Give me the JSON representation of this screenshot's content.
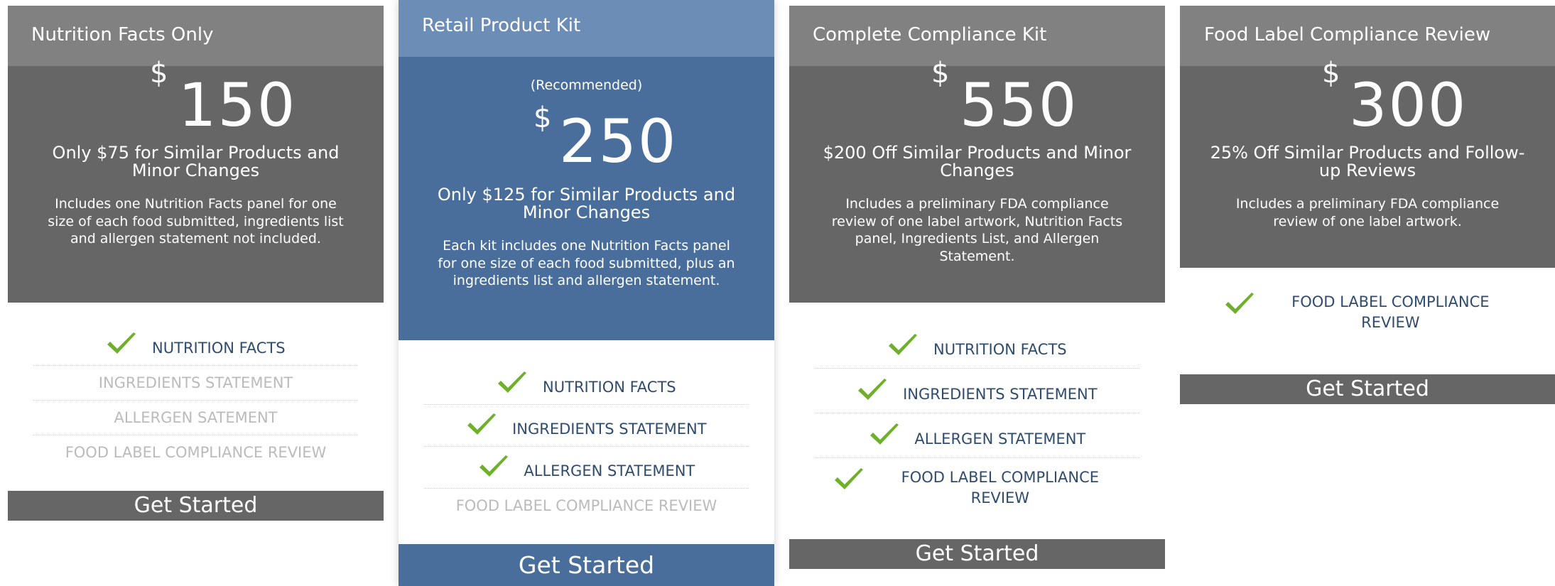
{
  "colors": {
    "header_gray": "#818181",
    "body_gray": "#666666",
    "header_blue": "#6c8db5",
    "body_blue": "#4a6e9b",
    "check_green": "#6fb02a",
    "feature_text": "#2f4b6e",
    "feature_disabled": "#bbbbbb"
  },
  "plans": [
    {
      "title": "Nutrition Facts Only",
      "currency": "$",
      "price": "150",
      "subtitle": "Only $75 for Similar Products and Minor Changes",
      "description": "Includes one Nutrition Facts panel for one size of each food submitted, ingredients list and allergen statement not included.",
      "features": [
        {
          "label": "NUTRITION FACTS",
          "included": true,
          "icon": "check-icon"
        },
        {
          "label": "INGREDIENTS STATEMENT",
          "included": false
        },
        {
          "label": "ALLERGEN SATEMENT",
          "included": false
        },
        {
          "label": "FOOD LABEL COMPLIANCE REVIEW",
          "included": false
        }
      ],
      "cta": "Get Started"
    },
    {
      "title": "Retail Product Kit",
      "recommended": "(Recommended)",
      "currency": "$",
      "price": "250",
      "subtitle": "Only $125 for Similar Products and Minor Changes",
      "description": "Each kit includes one Nutrition Facts panel for one size of each food submitted, plus an ingredients list and allergen statement.",
      "features": [
        {
          "label": "NUTRITION FACTS",
          "included": true,
          "icon": "check-icon"
        },
        {
          "label": "INGREDIENTS STATEMENT",
          "included": true,
          "icon": "check-icon"
        },
        {
          "label": "ALLERGEN STATEMENT",
          "included": true,
          "icon": "check-icon"
        },
        {
          "label": "FOOD LABEL COMPLIANCE REVIEW",
          "included": false
        }
      ],
      "cta": "Get Started"
    },
    {
      "title": "Complete Compliance Kit",
      "currency": "$",
      "price": "550",
      "subtitle": "$200 Off Similar Products and Minor Changes",
      "description": "Includes a preliminary FDA compliance review of one label artwork, Nutrition Facts panel, Ingredients List, and Allergen Statement.",
      "features": [
        {
          "label": "NUTRITION FACTS",
          "included": true,
          "icon": "check-icon"
        },
        {
          "label": "INGREDIENTS STATEMENT",
          "included": true,
          "icon": "check-icon"
        },
        {
          "label": "ALLERGEN STATEMENT",
          "included": true,
          "icon": "check-icon"
        },
        {
          "label": "FOOD LABEL COMPLIANCE REVIEW",
          "included": true,
          "icon": "check-icon"
        }
      ],
      "cta": "Get Started"
    },
    {
      "title": "Food Label Compliance Review",
      "currency": "$",
      "price": "300",
      "subtitle": "25% Off Similar Products and Follow-up Reviews",
      "description": "Includes a preliminary FDA compliance review of one label artwork.",
      "features": [
        {
          "label": "FOOD LABEL COMPLIANCE REVIEW",
          "included": true,
          "icon": "check-icon"
        }
      ],
      "cta": "Get Started"
    }
  ]
}
